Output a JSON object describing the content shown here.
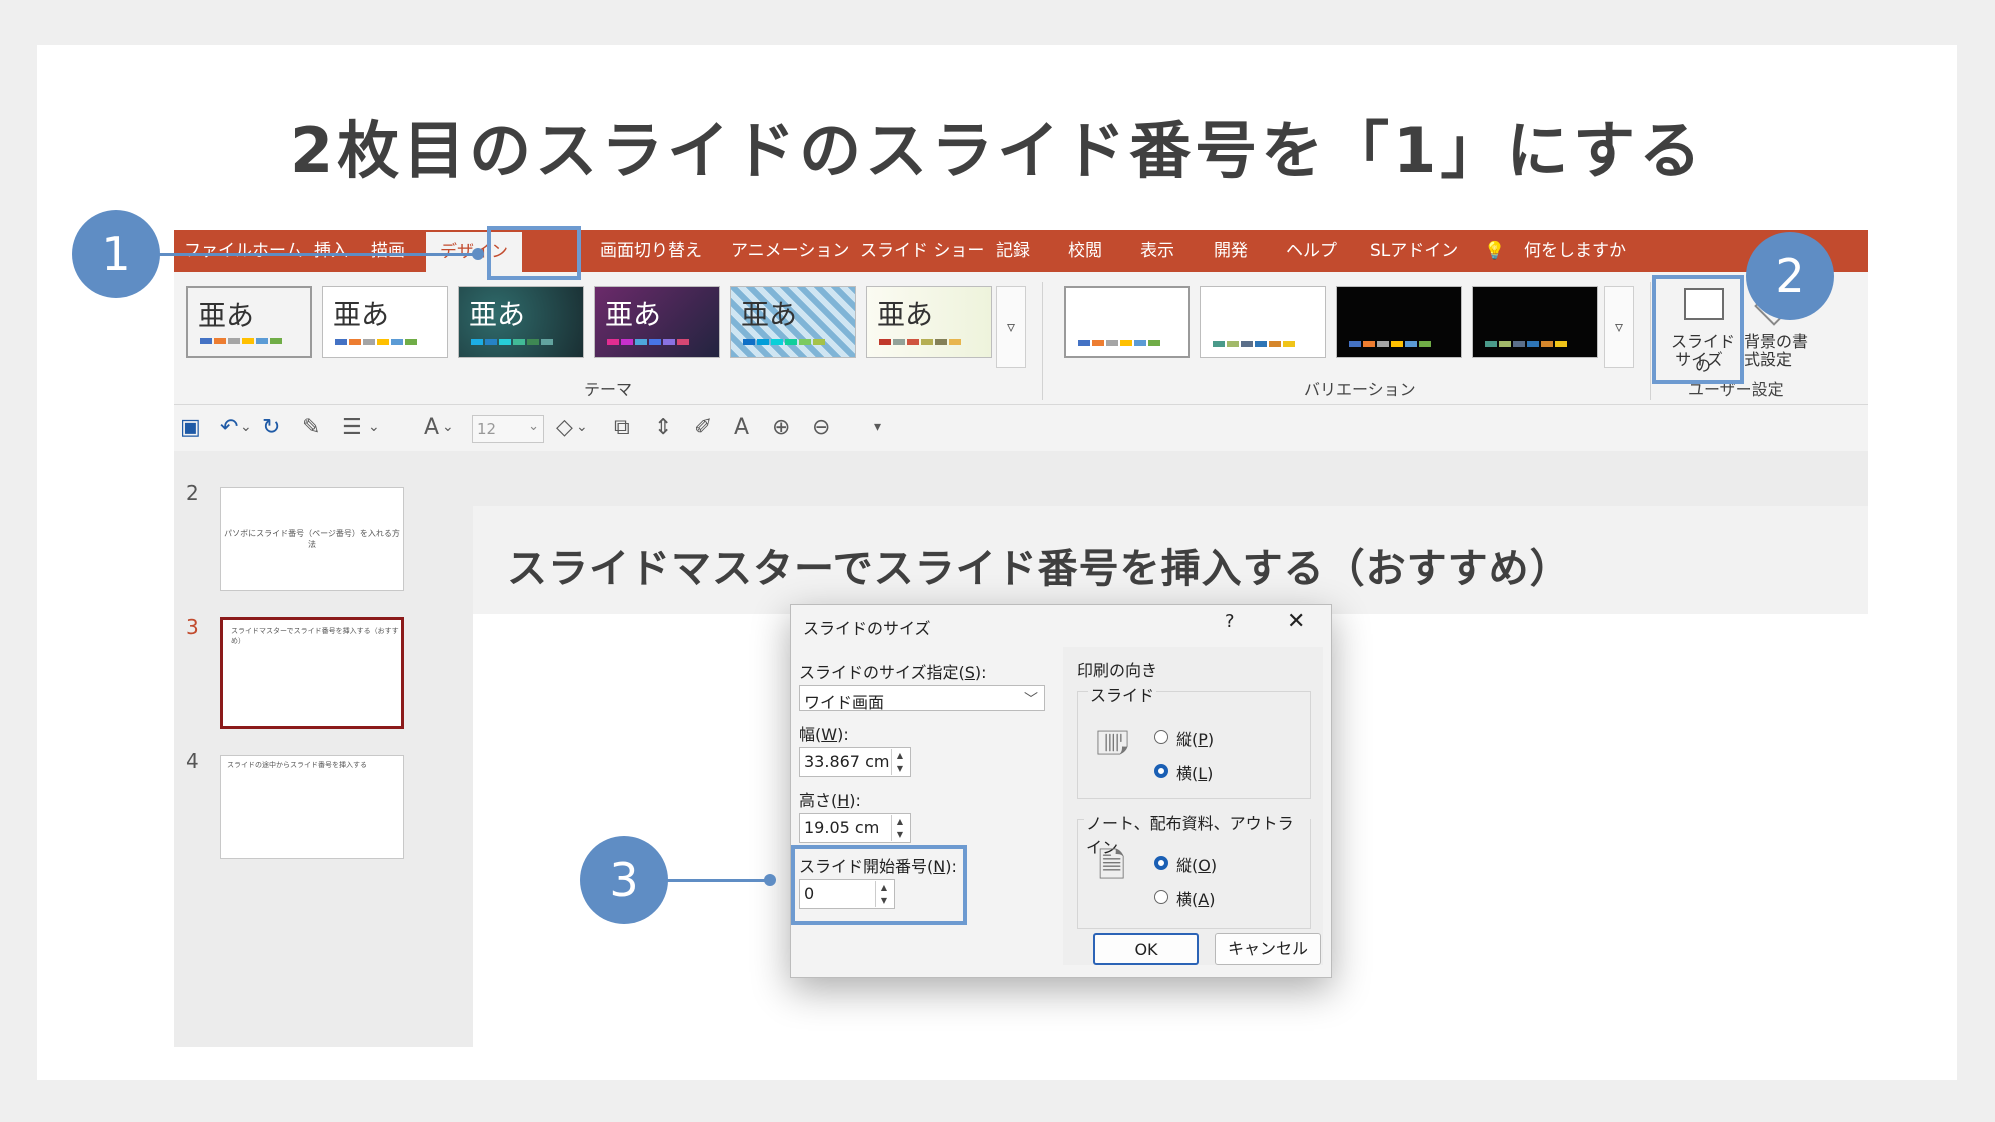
{
  "title": "2枚目のスライドのスライド番号を「1」にする",
  "ribbon": {
    "tabs": [
      "ファイル",
      "ホーム",
      "挿入",
      "描画",
      "デザイン",
      "画面切り替え",
      "アニメーション",
      "スライド ショー",
      "記録",
      "校閲",
      "表示",
      "開発",
      "ヘルプ",
      "SLアドイン",
      "何をしますか"
    ],
    "selected_tab": "デザイン",
    "theme_glyph": "亜あ",
    "group_theme": "テーマ",
    "group_variation": "バリエーション",
    "group_user": "ユーザー設定",
    "slide_size_btn_line1": "スライドの",
    "slide_size_btn_line2": "サイズ",
    "bg_format_line1": "背景の書",
    "bg_format_line2": "式設定",
    "gallery_more": "▿"
  },
  "qat": {
    "font_size": "12"
  },
  "thumbnails": [
    {
      "num": "2",
      "text": "パソボにスライド番号（ページ番号）を入れる方法"
    },
    {
      "num": "3",
      "text": "スライドマスターでスライド番号を挿入する（おすすめ）"
    },
    {
      "num": "4",
      "text": "スライドの途中からスライド番号を挿入する"
    }
  ],
  "slide": {
    "title": "スライドマスターでスライド番号を挿入する（おすすめ）"
  },
  "dialog": {
    "title": "スライドのサイズ",
    "help": "?",
    "close": "✕",
    "size_label": "スライドのサイズ指定(",
    "size_key": "S",
    "size_value": "ワイド画面",
    "width_label": "幅(",
    "width_key": "W",
    "width_value": "33.867 cm",
    "height_label": "高さ(",
    "height_key": "H",
    "height_value": "19.05 cm",
    "start_label": "スライド開始番号(",
    "start_key": "N",
    "start_value": "0",
    "orientation": "印刷の向き",
    "slide_group": "スライド",
    "portrait_p": "縦(",
    "portrait_p_key": "P",
    "landscape_l": "横(",
    "landscape_l_key": "L",
    "notes_group": "ノート、配布資料、アウトライン",
    "portrait_o": "縦(",
    "portrait_o_key": "O",
    "landscape_a": "横(",
    "landscape_a_key": "A",
    "ok": "OK",
    "cancel": "キャンセル"
  },
  "badges": [
    "1",
    "2",
    "3"
  ],
  "colors": {
    "accent": "#c24b2e",
    "callout": "#5f8dc4",
    "thumb_selected": "#8b1a1a"
  }
}
